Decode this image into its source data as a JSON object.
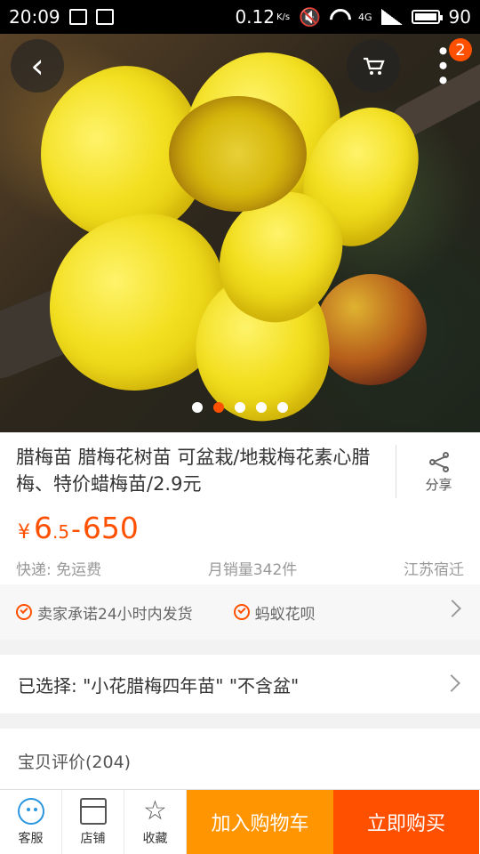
{
  "status_bar": {
    "time": "20:09",
    "network_speed": "0.12",
    "network_unit": "K/s",
    "mobile_network": "4G",
    "battery": "90",
    "icons": [
      "notes-icon",
      "image-icon",
      "mute-icon",
      "wifi-icon",
      "signal-icon",
      "battery-icon"
    ]
  },
  "hero": {
    "carousel": {
      "total": 5,
      "active": 2
    },
    "cart_badge": "2",
    "icons": [
      "back-icon",
      "cart-icon",
      "more-icon"
    ]
  },
  "product": {
    "title": "腊梅苗 腊梅花树苗 可盆栽/地栽梅花素心腊梅、特价蜡梅苗/2.9元",
    "share_label": "分享",
    "price": {
      "currency": "¥",
      "min_integer": "6",
      "min_decimal": ".5",
      "separator": "-",
      "max": "650"
    },
    "shipping": "快递: 免运费",
    "monthly_sales": "月销量342件",
    "location": "江苏宿迁"
  },
  "promises": [
    {
      "label": "卖家承诺24小时内发货"
    },
    {
      "label": "蚂蚁花呗"
    }
  ],
  "selection": {
    "text": "已选择: \"小花腊梅四年苗\" \"不含盆\""
  },
  "reviews": {
    "title": "宝贝评价(204)"
  },
  "bottom_bar": {
    "service": "客服",
    "store": "店铺",
    "favorite": "收藏",
    "add_to_cart": "加入购物车",
    "buy_now": "立即购买"
  },
  "colors": {
    "accent": "#ff5000",
    "cart_button": "#ff9500",
    "service_icon": "#2996e0",
    "muted_text": "#999999"
  }
}
